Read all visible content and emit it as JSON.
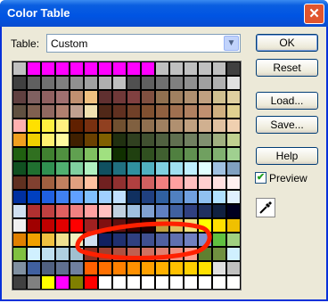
{
  "window": {
    "title": "Color Table",
    "close_glyph": "✕"
  },
  "table_field": {
    "label": "Table:",
    "selected": "Custom"
  },
  "buttons": {
    "ok": "OK",
    "reset": "Reset",
    "load": "Load...",
    "save": "Save...",
    "help": "Help"
  },
  "preview": {
    "label": "Preview",
    "checked": true
  },
  "icons": {
    "eyedropper": "eyedropper-icon",
    "dropdown": "chevron-down-icon"
  },
  "annotation_color": "#ff2000",
  "colors": [
    [
      "#c0c0c0",
      "#ff00ff",
      "#ff00ff",
      "#ff00ff",
      "#ff00ff",
      "#ff00ff",
      "#ff00ff",
      "#ff00ff",
      "#ff00ff",
      "#ff00ff",
      "#c0c0c0",
      "#c0c0c0",
      "#c0c0c0",
      "#c0c0c0",
      "#c0c0c0",
      "#404040"
    ],
    [
      "#404040",
      "#606060",
      "#707070",
      "#808080",
      "#909090",
      "#a0a0a0",
      "#b0b0b0",
      "#c0c0c0",
      "#505050",
      "#606060",
      "#707070",
      "#808080",
      "#909090",
      "#a0a0a0",
      "#b0b0b0",
      "#e0e0e0"
    ],
    [
      "#604040",
      "#806060",
      "#906060",
      "#a07070",
      "#c09070",
      "#f0c080",
      "#603030",
      "#703838",
      "#804040",
      "#805040",
      "#907050",
      "#a08060",
      "#b09070",
      "#c0a080",
      "#d0c090",
      "#e0d0a0"
    ],
    [
      "#605040",
      "#806050",
      "#906860",
      "#b08070",
      "#c0a090",
      "#f0e0b0",
      "#502818",
      "#603020",
      "#704028",
      "#805030",
      "#906040",
      "#a07050",
      "#b08060",
      "#c09070",
      "#d0b080",
      "#e0d090"
    ],
    [
      "#ffb0b0",
      "#ffe000",
      "#fff040",
      "#fff080",
      "#602000",
      "#783010",
      "#904020",
      "#705030",
      "#806040",
      "#907050",
      "#a08060",
      "#b09070",
      "#c0a080",
      "#d0b090",
      "#e0c0a0",
      "#f0d0b0"
    ],
    [
      "#f0a020",
      "#f0d000",
      "#fff070",
      "#fffaa0",
      "#402000",
      "#6a4000",
      "#806000",
      "#203010",
      "#304020",
      "#405030",
      "#506040",
      "#607050",
      "#708060",
      "#809070",
      "#a0b080",
      "#c0d090"
    ],
    [
      "#206010",
      "#307020",
      "#408030",
      "#509040",
      "#60a050",
      "#80c060",
      "#a0e080",
      "#103000",
      "#204010",
      "#305020",
      "#406030",
      "#508040",
      "#609050",
      "#70a060",
      "#80b070",
      "#a0d090"
    ],
    [
      "#105020",
      "#207030",
      "#309050",
      "#50b070",
      "#80d0a0",
      "#b0f0c0",
      "#105060",
      "#207080",
      "#3090a0",
      "#50b0c0",
      "#80d0e0",
      "#a0e0f0",
      "#c0f0ff",
      "#e0ffff",
      "#a0c0e0",
      "#80a0c0"
    ],
    [
      "#603020",
      "#804030",
      "#a06040",
      "#c08060",
      "#e0a080",
      "#ffc0a0",
      "#702020",
      "#903030",
      "#b04040",
      "#d06060",
      "#f08080",
      "#ffa0a0",
      "#ffc0c0",
      "#ffd0d0",
      "#ffe0e0",
      "#fff0f0"
    ],
    [
      "#0030a0",
      "#0040c0",
      "#2060e0",
      "#4080f0",
      "#60a0ff",
      "#80c0ff",
      "#a0d0ff",
      "#c0e0ff",
      "#103060",
      "#204080",
      "#3060a0",
      "#5080c0",
      "#70a0e0",
      "#90c0f0",
      "#b0e0ff",
      "#e0f0ff"
    ],
    [
      "#d0e0f0",
      "#b03030",
      "#c04040",
      "#e06060",
      "#f08080",
      "#ffa0a0",
      "#ffc0c0",
      "#c0d0e0",
      "#a0c0e0",
      "#80a0d0",
      "#6080c0",
      "#4060a0",
      "#304080",
      "#203060",
      "#102040",
      "#000020"
    ],
    [
      "#f0f0f0",
      "#a00000",
      "#c00000",
      "#e00000",
      "#ff0000",
      "#a02020",
      "#801010",
      "#601010",
      "#400000",
      "#200000",
      "#c0a040",
      "#e0c060",
      "#f0e080",
      "#ffff00",
      "#ffe000",
      "#f0c000"
    ],
    [
      "#e08000",
      "#f0a000",
      "#f0c040",
      "#f0e090",
      "#f0f0c0",
      "#d0e0f0",
      "#102060",
      "#203070",
      "#304080",
      "#405090",
      "#5060a0",
      "#6070b0",
      "#7080c0",
      "#8090d0",
      "#60c040",
      "#a0d080"
    ],
    [
      "#80c040",
      "#d0f0ff",
      "#c0e0f0",
      "#b0d0e0",
      "#a0c0d0",
      "#903020",
      "#a04030",
      "#b05040",
      "#c06050",
      "#d07060",
      "#e08070",
      "#f09080",
      "#ffa090",
      "#608030",
      "#709040",
      "#d0f0ff"
    ],
    [
      "#8090a0",
      "#4060a0",
      "#506080",
      "#607090",
      "#7080a0",
      "#ff6000",
      "#ff7000",
      "#ff8000",
      "#ff9000",
      "#ffa000",
      "#ffb000",
      "#ffc000",
      "#ffd000",
      "#ffe000",
      "#e0e0e0",
      "#c0c0c0"
    ],
    [
      "#404040",
      "#808080",
      "#ffff00",
      "#ff00ff",
      "#808000",
      "#ff0000",
      "#ffffff",
      "#ffffff",
      "#ffffff",
      "#ffffff",
      "#ffffff",
      "#ffffff",
      "#ffffff",
      "#ffffff",
      "#ffffff",
      "#ffffff"
    ]
  ]
}
